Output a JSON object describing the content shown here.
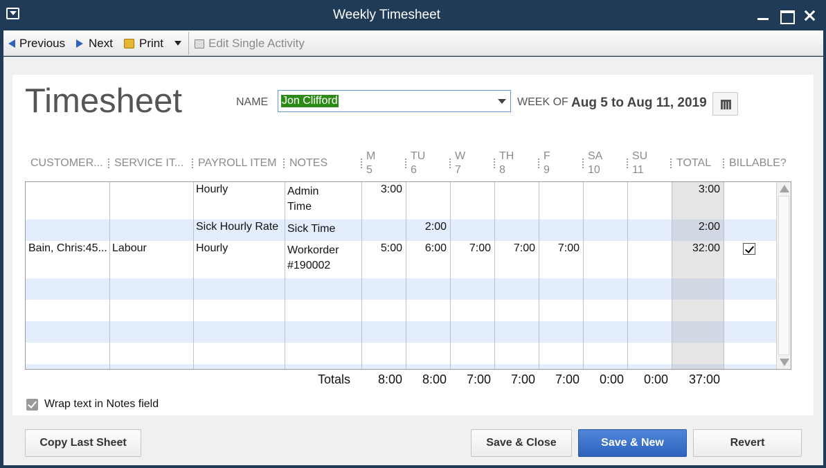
{
  "window": {
    "title": "Weekly Timesheet"
  },
  "toolbar": {
    "previous": "Previous",
    "next": "Next",
    "print": "Print",
    "edit_single": "Edit Single Activity"
  },
  "header": {
    "title": "Timesheet",
    "name_label": "NAME",
    "name_value": "Jon Clifford",
    "week_label": "WEEK OF",
    "week_value": "Aug 5 to Aug 11, 2019"
  },
  "columns": {
    "customer": "CUSTOMER...",
    "service": "SERVICE IT...",
    "payroll": "PAYROLL ITEM",
    "notes": "NOTES",
    "days": [
      {
        "d": "M",
        "n": "5"
      },
      {
        "d": "TU",
        "n": "6"
      },
      {
        "d": "W",
        "n": "7"
      },
      {
        "d": "TH",
        "n": "8"
      },
      {
        "d": "F",
        "n": "9"
      },
      {
        "d": "SA",
        "n": "10"
      },
      {
        "d": "SU",
        "n": "11"
      }
    ],
    "total": "TOTAL",
    "billable": "BILLABLE?"
  },
  "rows": [
    {
      "customer": "",
      "service": "",
      "payroll": "Hourly",
      "notes1": "Admin",
      "notes2": "Time",
      "days": [
        "3:00",
        "",
        "",
        "",
        "",
        "",
        ""
      ],
      "total": "3:00",
      "billable": false
    },
    {
      "customer": "",
      "service": "",
      "payroll": "Sick Hourly Rate",
      "notes1": "Sick Time",
      "notes2": "",
      "days": [
        "",
        "2:00",
        "",
        "",
        "",
        "",
        ""
      ],
      "total": "2:00",
      "billable": false
    },
    {
      "customer": "Bain, Chris:45...",
      "service": "Labour",
      "payroll": "Hourly",
      "notes1": "Workorder",
      "notes2": "#190002",
      "days": [
        "5:00",
        "6:00",
        "7:00",
        "7:00",
        "7:00",
        "",
        ""
      ],
      "total": "32:00",
      "billable": true
    }
  ],
  "totals": {
    "label": "Totals",
    "days": [
      "8:00",
      "8:00",
      "7:00",
      "7:00",
      "7:00",
      "0:00",
      "0:00"
    ],
    "total": "37:00"
  },
  "options": {
    "wrap_text": "Wrap text in Notes field",
    "wrap_checked": true
  },
  "buttons": {
    "copy_last": "Copy Last Sheet",
    "save_close": "Save & Close",
    "save_new": "Save & New",
    "revert": "Revert"
  }
}
